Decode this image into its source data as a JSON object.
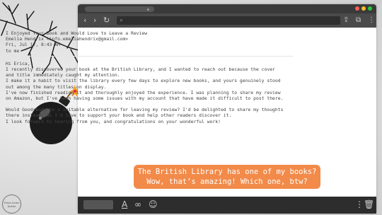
{
  "email": {
    "subject": "I Enjoyed Your Book and Would Love to Leave a Review",
    "from": "Emelia Hendrix <info.emeliahendrix@gmail.com>",
    "date": "Fri, Jul 17, 8:43 AM",
    "to": "to me",
    "greeting": "Hi Erica,",
    "lines": [
      "I recently discovered your book at the British Library, and I wanted to reach out because the cover",
      "and title immediately caught my attention.",
      "I make it a habit to visit the library every few days to explore new books, and yours genuinely stood",
      "out among the many titles on display.",
      "I've now finished reading it and thoroughly enjoyed the experience. I was planning to share my review",
      "on Amazon, but I've been having some issues with my account that have made it difficult to post there."
    ],
    "lines2": [
      "Would Goodreads be a suitable alternative for leaving my review? I'd be delighted to share my thoughts",
      "there instead, as I'd love to support your book and help other readers discover it.",
      "I look forward to hearing from you, and congratulations on your wonderful work!"
    ]
  },
  "bubble": {
    "line1": "The British Library has one of my books?",
    "line2": "Wow, that’s amazing! Which one, btw?",
    "color": "#f28a49"
  },
  "watermark": "Erica Jones Author",
  "icons": [
    "back-icon",
    "forward-icon",
    "reload-icon",
    "search-icon",
    "share-icon",
    "copy-icon",
    "menu-icon",
    "text-format-icon",
    "link-icon",
    "emoji-icon",
    "more-icon",
    "trash-icon",
    "bomb-icon"
  ]
}
